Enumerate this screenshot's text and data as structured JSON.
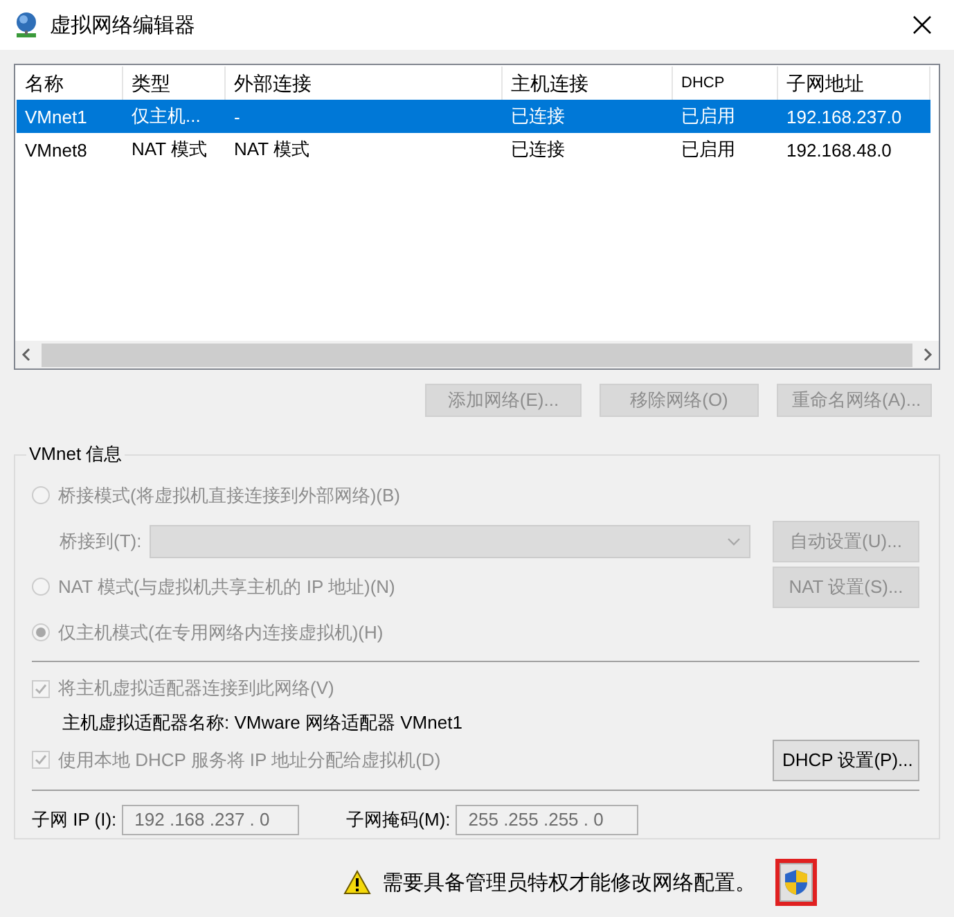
{
  "window": {
    "title": "虚拟网络编辑器"
  },
  "network_table": {
    "columns": [
      "名称",
      "类型",
      "外部连接",
      "主机连接",
      "DHCP",
      "子网地址"
    ],
    "rows": [
      {
        "cells": [
          "VMnet1",
          "仅主机...",
          "-",
          "已连接",
          "已启用",
          "192.168.237.0"
        ],
        "selected": true
      },
      {
        "cells": [
          "VMnet8",
          "NAT 模式",
          "NAT 模式",
          "已连接",
          "已启用",
          "192.168.48.0"
        ],
        "selected": false
      }
    ]
  },
  "table_buttons": [
    {
      "label": "添加网络(E)...",
      "disabled": true
    },
    {
      "label": "移除网络(O)",
      "disabled": true
    },
    {
      "label": "重命名网络(A)...",
      "disabled": true
    }
  ],
  "vmnet_info": {
    "title": "VMnet 信息",
    "modes": [
      {
        "label": "桥接模式(将虚拟机直接连接到外部网络)(B)",
        "selected": false,
        "disabled": true
      },
      {
        "label": "NAT 模式(与虚拟机共享主机的 IP 地址)(N)",
        "selected": false,
        "disabled": true
      },
      {
        "label": "仅主机模式(在专用网络内连接虚拟机)(H)",
        "selected": true,
        "disabled": true
      }
    ],
    "bridge_to": {
      "label": "桥接到(T):",
      "disabled": true
    },
    "auto_button": {
      "label": "自动设置(U)...",
      "disabled": true
    },
    "nat_button": {
      "label": "NAT 设置(S)...",
      "disabled": true
    },
    "connect_adapter": {
      "label": "将主机虚拟适配器连接到此网络(V)",
      "checked": true,
      "disabled": true
    },
    "adapter_name": "主机虚拟适配器名称: VMware 网络适配器 VMnet1",
    "use_dhcp": {
      "label": "使用本地 DHCP 服务将 IP 地址分配给虚拟机(D)",
      "checked": true,
      "disabled": true
    },
    "dhcp_button": {
      "label": "DHCP 设置(P)...",
      "disabled": false
    },
    "subnet_ip": {
      "label": "子网 IP (I):",
      "value": "192 .168 .237 . 0"
    },
    "subnet_mask": {
      "label": "子网掩码(M):",
      "value": "255 .255 .255 . 0"
    }
  },
  "footer": {
    "warning": "需要具备管理员特权才能修改网络配置。",
    "shield_button": {
      "highlighted": true
    }
  }
}
